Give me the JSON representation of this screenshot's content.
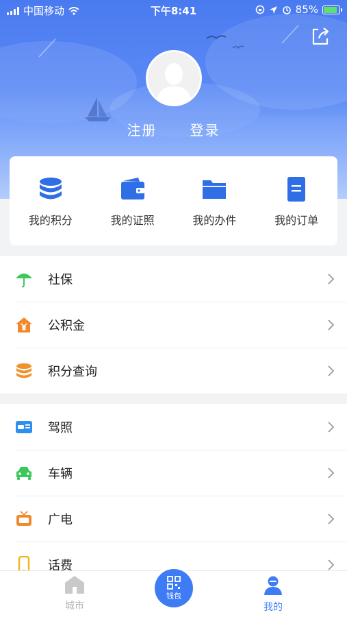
{
  "status_bar": {
    "carrier": "中国移动",
    "time": "下午8:41",
    "battery": "85%"
  },
  "profile": {
    "register_label": "注册",
    "login_label": "登录"
  },
  "quick_actions": [
    {
      "label": "我的积分",
      "icon": "coins-stack-icon"
    },
    {
      "label": "我的证照",
      "icon": "wallet-icon"
    },
    {
      "label": "我的办件",
      "icon": "folder-icon"
    },
    {
      "label": "我的订单",
      "icon": "document-icon"
    }
  ],
  "group1": [
    {
      "label": "社保",
      "icon": "umbrella-icon",
      "color": "#3cc85a"
    },
    {
      "label": "公积金",
      "icon": "house-yen-icon",
      "color": "#f08a2c"
    },
    {
      "label": "积分查询",
      "icon": "coins-icon",
      "color": "#f0922e"
    }
  ],
  "group2": [
    {
      "label": "驾照",
      "icon": "license-card-icon",
      "color": "#2f8ff0"
    },
    {
      "label": "车辆",
      "icon": "car-icon",
      "color": "#3cc85a"
    },
    {
      "label": "广电",
      "icon": "tv-icon",
      "color": "#f08a2c"
    },
    {
      "label": "话费",
      "icon": "phone-icon",
      "color": "#f2b51d"
    }
  ],
  "tabbar": {
    "city": "城市",
    "wallet": "钱包",
    "mine": "我的"
  },
  "colors": {
    "accent": "#3d7cf5",
    "tab_inactive": "#b5b5b5"
  }
}
